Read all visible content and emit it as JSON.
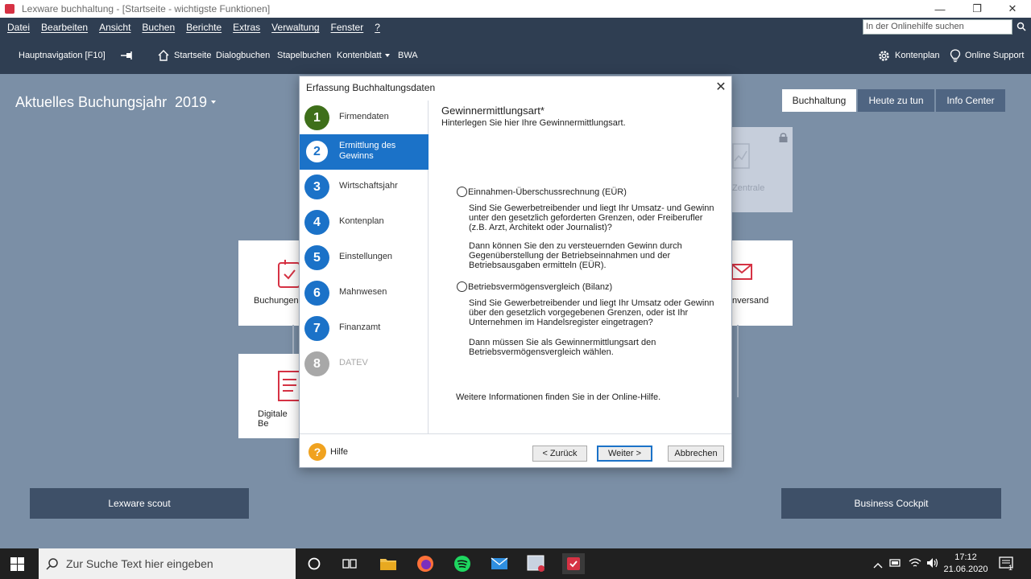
{
  "window": {
    "title": "Lexware buchhaltung - [Startseite - wichtigste Funktionen]"
  },
  "menu": [
    "Datei",
    "Bearbeiten",
    "Ansicht",
    "Buchen",
    "Berichte",
    "Extras",
    "Verwaltung",
    "Fenster",
    "?"
  ],
  "help_search": {
    "placeholder": "In der Onlinehilfe suchen"
  },
  "nav": {
    "main_nav": "Hauptnavigation [F10]",
    "items": [
      "Startseite",
      "Dialogbuchen",
      "Stapelbuchen",
      "Kontenblatt",
      "BWA"
    ],
    "kontenplan": "Kontenplan",
    "support": "Online Support"
  },
  "fiscal_year": {
    "label": "Aktuelles Buchungsjahr",
    "year": "2019"
  },
  "tabs": [
    "Buchhaltung",
    "Heute zu tun",
    "Info Center"
  ],
  "tiles": {
    "buchungen": "Buchungen",
    "digitale": "Digitale Be",
    "versand": "nversand",
    "zentrale": "Zentrale"
  },
  "bottom": {
    "scout": "Lexware scout",
    "cockpit": "Business Cockpit"
  },
  "dialog": {
    "title": "Erfassung Buchhaltungsdaten",
    "steps": [
      {
        "num": "1",
        "label": "Firmendaten"
      },
      {
        "num": "2",
        "label": "Ermittlung des Gewinns"
      },
      {
        "num": "3",
        "label": "Wirtschaftsjahr"
      },
      {
        "num": "4",
        "label": "Kontenplan"
      },
      {
        "num": "5",
        "label": "Einstellungen"
      },
      {
        "num": "6",
        "label": "Mahnwesen"
      },
      {
        "num": "7",
        "label": "Finanzamt"
      },
      {
        "num": "8",
        "label": "DATEV"
      }
    ],
    "heading": "Gewinnermittlungsart*",
    "subheading": "Hinterlegen Sie hier Ihre Gewinnermittlungsart.",
    "option1": {
      "label": "Einnahmen-Überschussrechnung (EÜR)",
      "p1": "Sind Sie Gewerbetreibender und liegt Ihr Umsatz- und Gewinn\nunter den gesetzlich geforderten Grenzen, oder Freiberufler\n(z.B. Arzt, Architekt oder Journalist)?",
      "p2": "Dann können Sie den zu versteuernden Gewinn durch\nGegenüberstellung der Betriebseinnahmen und der\nBetriebsausgaben ermitteln (EÜR)."
    },
    "option2": {
      "label": "Betriebsvermögensvergleich (Bilanz)",
      "p1": "Sind Sie Gewerbetreibender und liegt Ihr Umsatz oder Gewinn\nüber den gesetzlich vorgegebenen Grenzen, oder ist Ihr\nUnternehmen im Handelsregister eingetragen?",
      "p2": "Dann müssen Sie als Gewinnermittlungsart den\nBetriebsvermögensvergleich wählen."
    },
    "more_info": "Weitere Informationen finden Sie in der Online-Hilfe.",
    "help": "Hilfe",
    "back": "< Zurück",
    "next": "Weiter >",
    "cancel": "Abbrechen"
  },
  "taskbar": {
    "search": "Zur Suche Text hier eingeben",
    "time": "17:12",
    "date": "21.06.2020",
    "notification_count": "1"
  }
}
